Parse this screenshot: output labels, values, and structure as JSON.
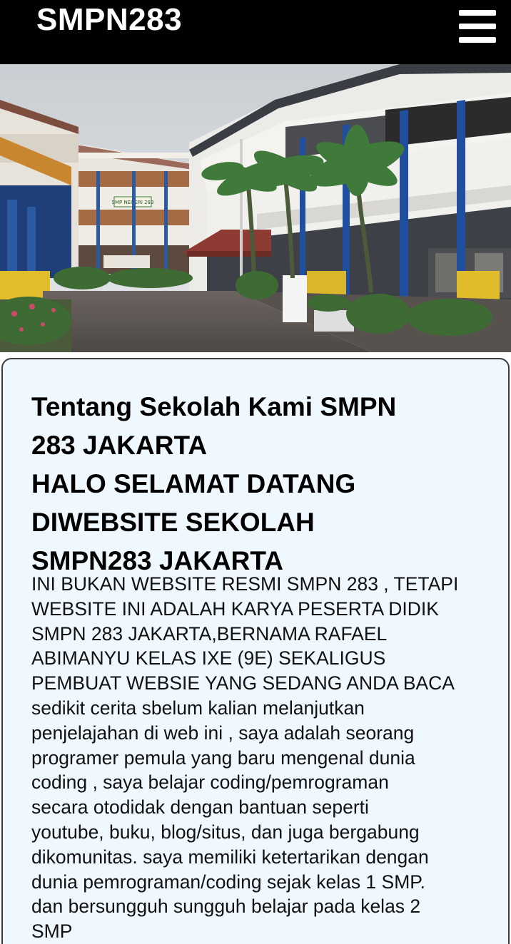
{
  "navbar": {
    "brand": "SMPN283",
    "menu_icon": "hamburger-menu-icon"
  },
  "hero": {
    "image_description_name": "school-building-photo",
    "banner_sign": "SMP NEGERI 283"
  },
  "about": {
    "heading_lines": [
      "Tentang Sekolah Kami SMPN",
      "283 JAKARTA",
      "HALO SELAMAT DATANG",
      "DIWEBSITE SEKOLAH",
      "SMPN283 JAKARTA"
    ],
    "body_lines": [
      "INI BUKAN WEBSITE RESMI SMPN 283 , TETAPI",
      "WEBSITE INI ADALAH KARYA PESERTA DIDIK",
      "SMPN 283 JAKARTA,BERNAMA RAFAEL",
      "ABIMANYU KELAS IXE (9E) SEKALIGUS",
      "PEMBUAT WEBSIE YANG SEDANG ANDA BACA",
      "sedikit cerita sbelum kalian melanjutkan",
      "penjelajahan di web ini , saya adalah seorang",
      "programer pemula yang baru mengenal dunia",
      "coding , saya belajar coding/pemrograman",
      "secara otodidak dengan bantuan seperti",
      "youtube, buku, blog/situs, dan juga bergabung",
      "dikomunitas. saya memiliki ketertarikan dengan",
      "dunia pemrograman/coding sejak kelas 1 SMP.",
      "dan bersungguh sungguh belajar pada kelas 2",
      "SMP"
    ]
  },
  "colors": {
    "navbar_bg": "#000000",
    "card_bg": "#f0f8ff",
    "card_border": "#3d3d3d"
  }
}
